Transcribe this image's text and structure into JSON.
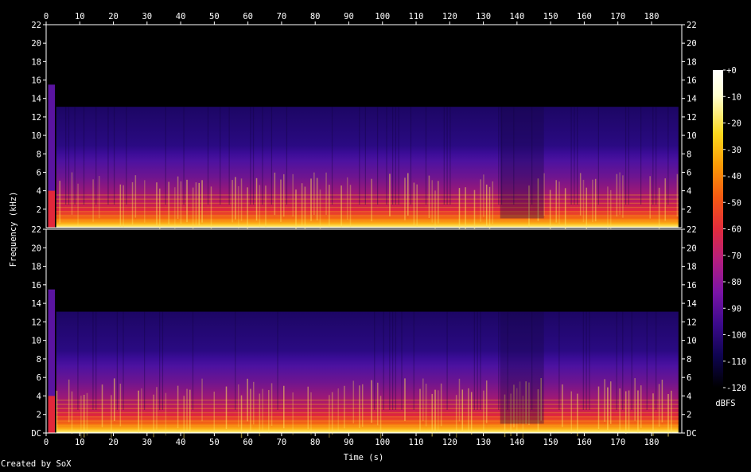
{
  "footer": {
    "credit": "Created by SoX"
  },
  "chart_data": {
    "type": "heatmap",
    "xlabel": "Time (s)",
    "ylabel": "Frequency (kHz)",
    "xlim": [
      0,
      189
    ],
    "ylim_khz": [
      0,
      22
    ],
    "x_ticks": [
      0,
      10,
      20,
      30,
      40,
      50,
      60,
      70,
      80,
      90,
      100,
      110,
      120,
      130,
      140,
      150,
      160,
      170,
      180
    ],
    "y_tick_labels": [
      "DC",
      "2",
      "4",
      "6",
      "8",
      "10",
      "12",
      "14",
      "16",
      "18",
      "20",
      "22"
    ],
    "channels": 2,
    "content_start_s": 3,
    "content_end_s": 188,
    "bandwidth_khz": 13.1,
    "colorbar": {
      "label": "dBFS",
      "ticks": [
        "+0",
        "-10",
        "-20",
        "-30",
        "-40",
        "-50",
        "-60",
        "-70",
        "-80",
        "-90",
        "-100",
        "-110",
        "-120"
      ],
      "range_db": [
        -120,
        0
      ],
      "colors": [
        "#000000",
        "#0e0450",
        "#3c0a8c",
        "#7a14a6",
        "#b41e80",
        "#e12c3c",
        "#f55a12",
        "#fb9a06",
        "#fcd81e",
        "#ffffd0",
        "#ffffff"
      ]
    }
  }
}
